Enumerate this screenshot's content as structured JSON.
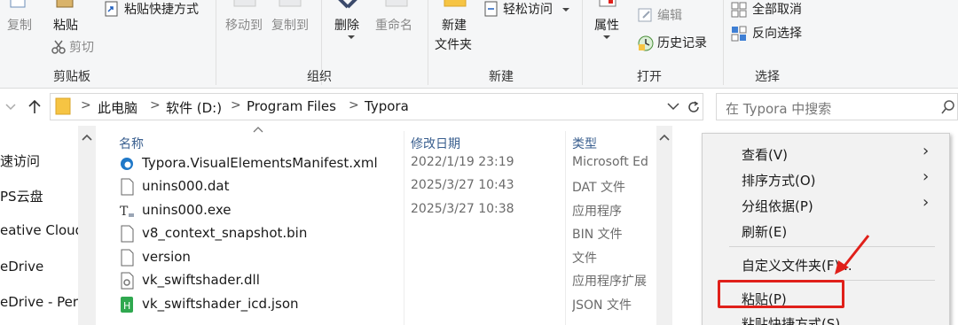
{
  "ribbon": {
    "copy": "复制",
    "paste": "粘贴",
    "paste_shortcut": "粘贴快捷方式",
    "cut": "剪切",
    "clipboard_group": "剪贴板",
    "move_to": "移动到",
    "copy_to": "复制到",
    "delete": "删除",
    "rename": "重命名",
    "organize_group": "组织",
    "new_folder_line1": "新建",
    "new_folder_line2": "文件夹",
    "easy_access": "轻松访问",
    "new_group": "新建",
    "properties": "属性",
    "edit": "编辑",
    "history": "历史记录",
    "open_group": "打开",
    "select_none": "全部取消",
    "invert_selection": "反向选择",
    "select_group": "选择"
  },
  "address": {
    "crumbs": [
      "此电脑",
      "软件 (D:)",
      "Program Files",
      "Typora"
    ],
    "separator": ">",
    "search_placeholder": "在 Typora 中搜索"
  },
  "nav": {
    "items": [
      "速访问",
      "PS云盘",
      "eative Cloud",
      "eDrive",
      "eDrive - Per"
    ]
  },
  "columns": {
    "name": "名称",
    "date": "修改日期",
    "type": "类型"
  },
  "files": [
    {
      "name": "Typora.VisualElementsManifest.xml",
      "date": "2022/1/19 23:19",
      "type": "Microsoft Ed",
      "icon": "edge-icon"
    },
    {
      "name": "unins000.dat",
      "date": "2025/3/27 10:43",
      "type": "DAT 文件",
      "icon": "file-icon"
    },
    {
      "name": "unins000.exe",
      "date": "2025/3/27 10:38",
      "type": "应用程序",
      "icon": "exe-icon"
    },
    {
      "name": "v8_context_snapshot.bin",
      "date": "",
      "type": "BIN 文件",
      "icon": "file-icon"
    },
    {
      "name": "version",
      "date": "",
      "type": "文件",
      "icon": "file-icon"
    },
    {
      "name": "vk_swiftshader.dll",
      "date": "",
      "type": "应用程序扩展",
      "icon": "dll-icon"
    },
    {
      "name": "vk_swiftshader_icd.json",
      "date": "",
      "type": "JSON 文件",
      "icon": "json-icon"
    }
  ],
  "context_menu": {
    "items": [
      {
        "label": "查看(V)",
        "submenu": true
      },
      {
        "label": "排序方式(O)",
        "submenu": true
      },
      {
        "label": "分组依据(P)",
        "submenu": true
      },
      {
        "label": "刷新(E)",
        "submenu": false
      },
      {
        "label": "自定义文件夹(F)...",
        "submenu": false
      },
      {
        "label": "粘贴(P)",
        "submenu": false
      },
      {
        "label": "粘贴快捷方式(S)",
        "submenu": false
      }
    ]
  },
  "colors": {
    "highlight_annotation": "#e0201a",
    "folder": "#f6c443",
    "header_text": "#3a5f8f",
    "json_icon": "#2fa84f",
    "edge_icon": "#1f78c8"
  }
}
